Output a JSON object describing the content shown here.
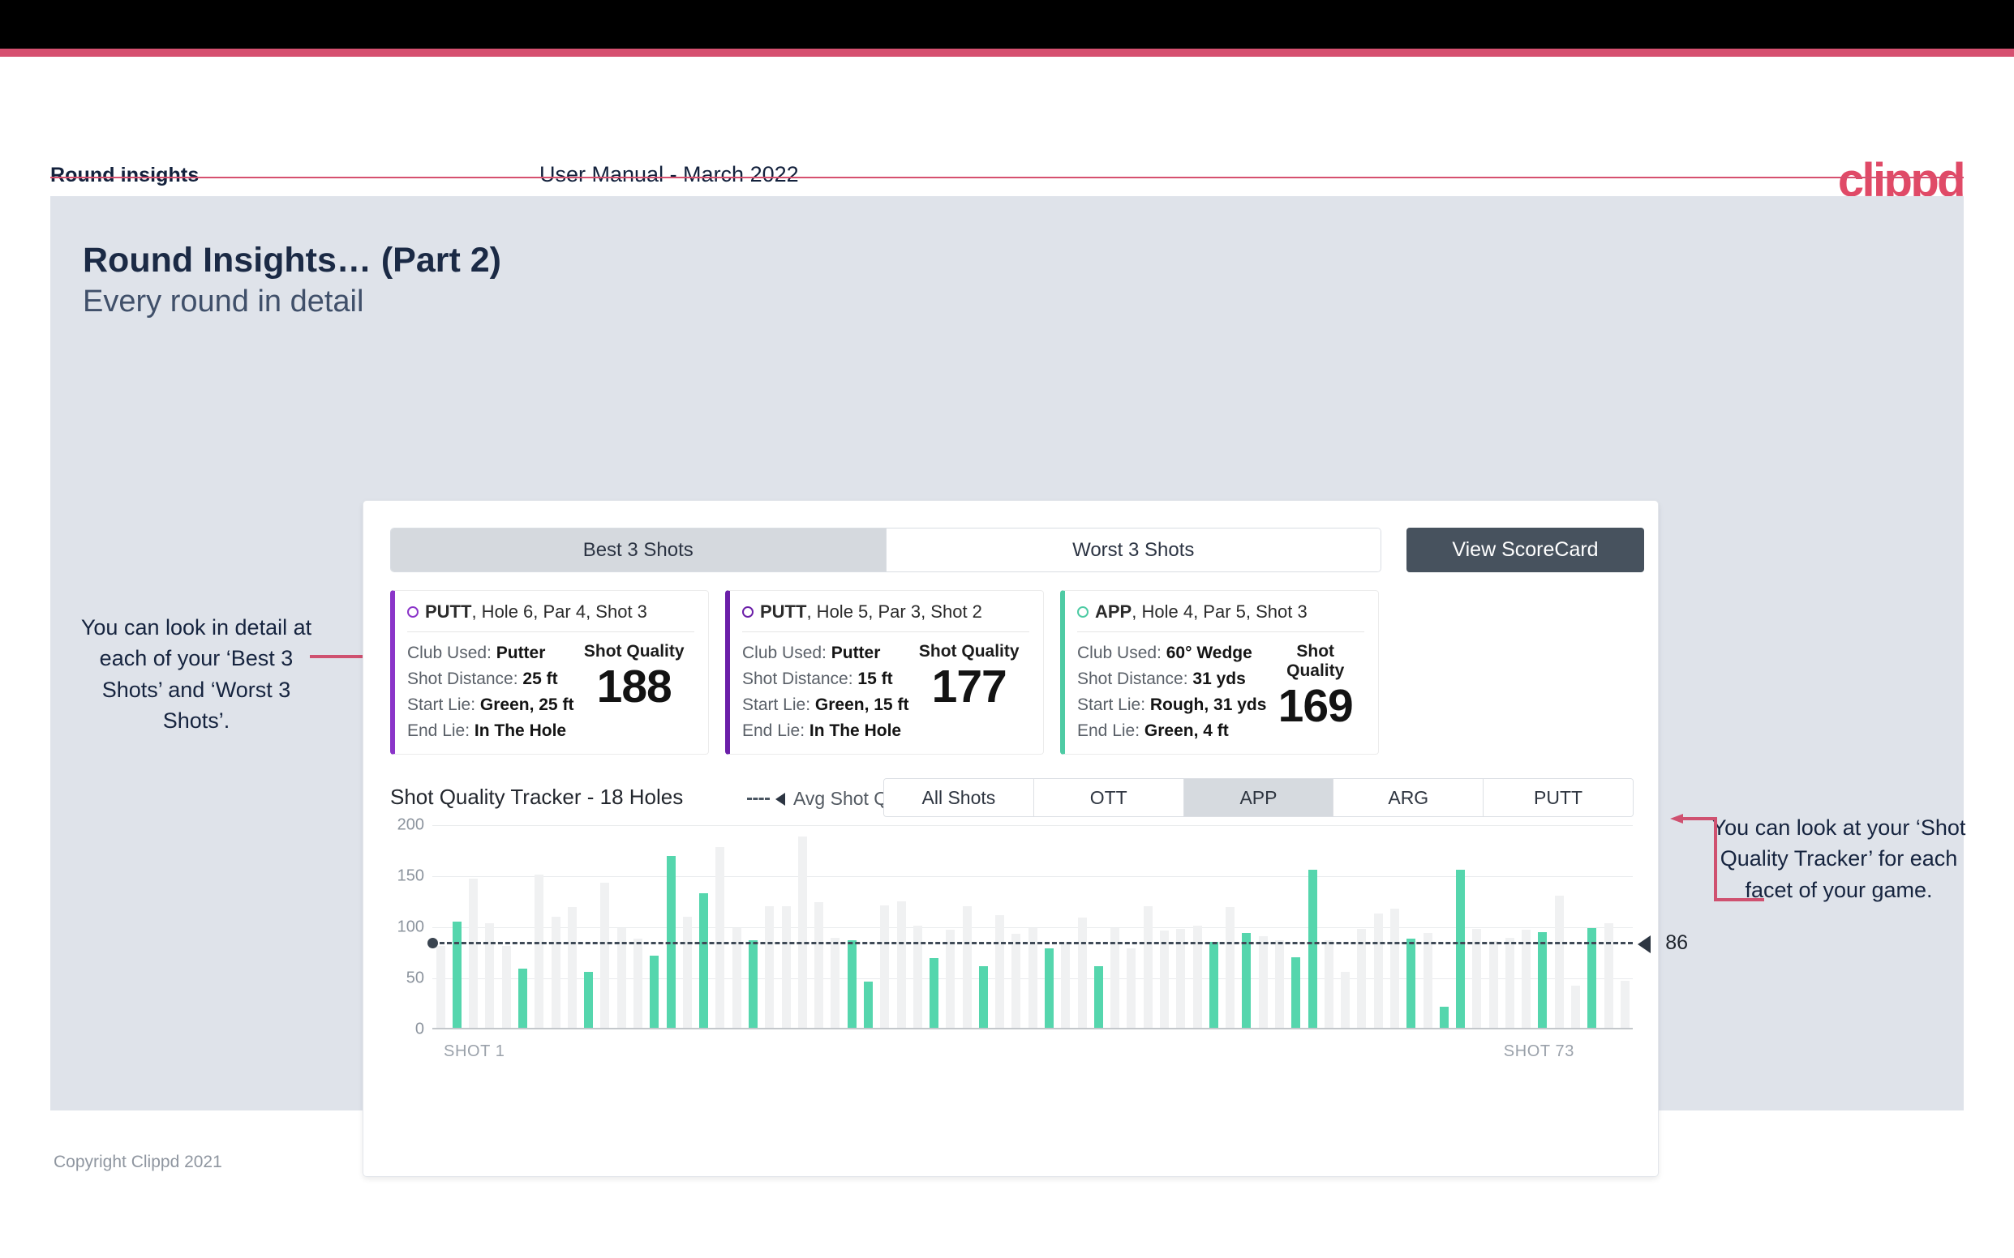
{
  "topbar": {
    "accent_color": "#d6506f",
    "bar_color": "#000000"
  },
  "header": {
    "left_label": "Round insights",
    "center_label": "User Manual - March 2022",
    "logo_text": "clippd"
  },
  "slide": {
    "title": "Round Insights… (Part 2)",
    "subtitle": "Every round in detail"
  },
  "annotations": {
    "left": "You can look in detail at each of your ‘Best 3 Shots’ and ‘Worst 3 Shots’.",
    "right": "You can look at your ‘Shot Quality Tracker’ for each facet of your game."
  },
  "panel": {
    "segmented": {
      "options": [
        "Best 3 Shots",
        "Worst 3 Shots"
      ],
      "selected": "Best 3 Shots"
    },
    "scorecard_button": "View ScoreCard",
    "shot_cards": [
      {
        "facet": "PUTT",
        "facet_color": "#8b35c9",
        "context": ", Hole 6, Par 4, Shot 3",
        "club_label": "Club Used:",
        "club_value": "Putter",
        "distance_label": "Shot Distance:",
        "distance_value": "25 ft",
        "start_label": "Start Lie:",
        "start_value": "Green, 25 ft",
        "end_label": "End Lie:",
        "end_value": "In The Hole",
        "quality_label": "Shot Quality",
        "quality_value": "188"
      },
      {
        "facet": "PUTT",
        "facet_color": "#6b1fa8",
        "context": ", Hole 5, Par 3, Shot 2",
        "club_label": "Club Used:",
        "club_value": "Putter",
        "distance_label": "Shot Distance:",
        "distance_value": "15 ft",
        "start_label": "Start Lie:",
        "start_value": "Green, 15 ft",
        "end_label": "End Lie:",
        "end_value": "In The Hole",
        "quality_label": "Shot Quality",
        "quality_value": "177"
      },
      {
        "facet": "APP",
        "facet_color": "#4ecba4",
        "context": ", Hole 4, Par 5, Shot 3",
        "club_label": "Club Used:",
        "club_value": "60° Wedge",
        "distance_label": "Shot Distance:",
        "distance_value": "31 yds",
        "start_label": "Start Lie:",
        "start_value": "Rough, 31 yds",
        "end_label": "End Lie:",
        "end_value": "Green, 4 ft",
        "quality_label": "Shot Quality",
        "quality_value": "169"
      }
    ],
    "tracker": {
      "title": "Shot Quality Tracker - 18 Holes",
      "legend_label": "Avg Shot Quality",
      "facets": {
        "options": [
          "All Shots",
          "OTT",
          "APP",
          "ARG",
          "PUTT"
        ],
        "selected": "APP"
      }
    }
  },
  "chart_data": {
    "type": "bar",
    "title": "Shot Quality Tracker - 18 Holes",
    "xlabel": "",
    "ylabel": "",
    "ylim": [
      0,
      200
    ],
    "yticks": [
      0,
      50,
      100,
      150,
      200
    ],
    "grid": true,
    "x_tick_labels": [
      "SHOT 1",
      "SHOT 73"
    ],
    "average_line": {
      "value": 86,
      "label": "86",
      "style": "dashed"
    },
    "highlight_color": "#55d6ad",
    "dim_color": "#f0f1f2",
    "highlight_facet": "APP",
    "series": [
      {
        "name": "Shot Quality",
        "values": [
          80,
          104,
          146,
          102,
          80,
          58,
          150,
          109,
          118,
          55,
          142,
          98,
          87,
          71,
          168,
          109,
          132,
          177,
          98,
          86,
          119,
          119,
          187,
          123,
          88,
          86,
          45,
          120,
          124,
          100,
          68,
          96,
          119,
          60,
          110,
          92,
          98,
          78,
          84,
          108,
          60,
          98,
          78,
          119,
          95,
          97,
          100,
          84,
          118,
          93,
          90,
          86,
          69,
          155,
          86,
          55,
          97,
          112,
          117,
          87,
          93,
          21,
          155,
          97,
          85,
          88,
          96,
          94,
          129,
          41,
          98,
          102,
          46
        ],
        "highlighted": [
          false,
          true,
          false,
          false,
          false,
          true,
          false,
          false,
          false,
          true,
          false,
          false,
          false,
          true,
          true,
          false,
          true,
          false,
          false,
          true,
          false,
          false,
          false,
          false,
          false,
          true,
          true,
          false,
          false,
          false,
          true,
          false,
          false,
          true,
          false,
          false,
          false,
          true,
          false,
          false,
          true,
          false,
          false,
          false,
          false,
          false,
          false,
          true,
          false,
          true,
          false,
          false,
          true,
          true,
          false,
          false,
          false,
          false,
          false,
          true,
          false,
          true,
          true,
          false,
          false,
          false,
          false,
          true,
          false,
          false,
          true,
          false,
          false
        ]
      }
    ]
  },
  "footer": {
    "copyright": "Copyright Clippd 2021"
  }
}
